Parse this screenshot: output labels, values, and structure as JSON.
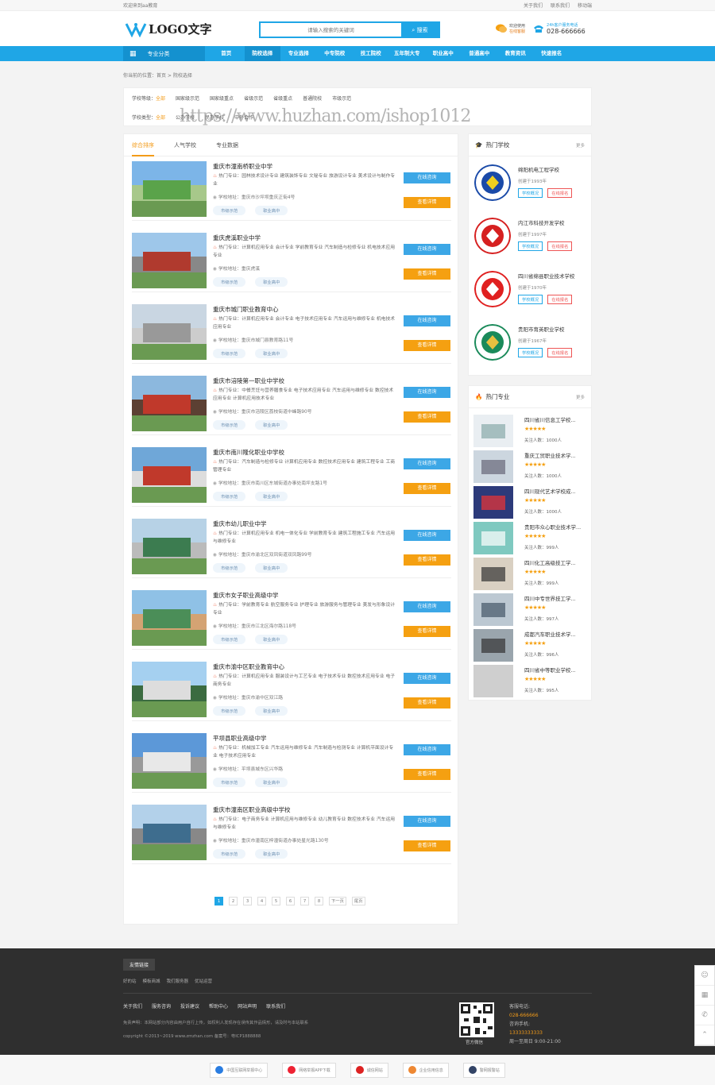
{
  "topbar": {
    "welcome": "欢迎来到aa教育",
    "links": [
      "关于我们",
      "联系我们",
      "移动端"
    ]
  },
  "header": {
    "logo_text": "LOGO文字",
    "search_placeholder": "请输入搜索的关键词",
    "search_button": "搜索",
    "contact1_line1": "欢迎使用",
    "contact1_line2": "在线客服",
    "contact2_line1": "24h客户服务电话",
    "contact2_line2": "028-666666"
  },
  "nav": {
    "category": "专业分类",
    "items": [
      "首页",
      "院校选择",
      "专业选择",
      "中专院校",
      "技工院校",
      "五年制大专",
      "职业高中",
      "普通高中",
      "教育资讯",
      "快速报名"
    ],
    "active_index": 1
  },
  "breadcrumb": "你当前的位置：首页 > 院校选择",
  "filter": {
    "level_label": "学校等级：",
    "level_options": [
      "全部",
      "国家级示范",
      "国家级重点",
      "省级示范",
      "省级重点",
      "普通院校",
      "市级示范"
    ],
    "type_label": "学校类型：",
    "type_options": [
      "全部",
      "公办学校",
      "民办学校",
      "中外合作"
    ]
  },
  "watermark": "https://www.huzhan.com/ishop1012",
  "tabs": [
    "综合排序",
    "人气学校",
    "专业数据"
  ],
  "schools": [
    {
      "name": "重庆市潼南桥职业中学",
      "majors": "热门专业：园林技术设计专业 建筑装饰专业 文秘专业 旅游设计专业 美术设计与制作专业",
      "address": "学校地址：重庆市沙坪坝重庆正街4号",
      "tags": [
        "市级示范",
        "职业高中"
      ],
      "btn1": "在线咨询",
      "btn2": "查看详情"
    },
    {
      "name": "重庆虎溪职业中学",
      "majors": "热门专业：计算机应用专业 会计专业 学前教育专业 汽车制造与检修专业 机电技术应用专业",
      "address": "学校地址：重庆虎溪",
      "tags": [
        "市级示范",
        "职业高中"
      ],
      "btn1": "在线咨询",
      "btn2": "查看详情"
    },
    {
      "name": "重庆市城门职业教育中心",
      "majors": "热门专业：计算机应用专业 会计专业 电子技术应用专业 汽车运用与维修专业 机电技术应用专业",
      "address": "学校地址：重庆市城门县教育路11号",
      "tags": [
        "市级示范",
        "职业高中"
      ],
      "btn1": "在线咨询",
      "btn2": "查看详情"
    },
    {
      "name": "重庆市涪陵第一职业中学校",
      "majors": "热门专业：中餐烹饪与营养膳食专业 电子技术应用专业 汽车运用与维修专业 数控技术应用专业 计算机应用技术专业",
      "address": "学校地址：重庆市涪陵区荔枝街道中峰路90号",
      "tags": [
        "市级示范",
        "职业高中"
      ],
      "btn1": "在线咨询",
      "btn2": "查看详情"
    },
    {
      "name": "重庆市南川隆化职业中学校",
      "majors": "热门专业：汽车制造与检修专业 计算机应用专业 数控技术应用专业 建筑工程专业 工商管理专业",
      "address": "学校地址：重庆市南川区东城街道办事处南坪支路1号",
      "tags": [
        "市级示范",
        "职业高中"
      ],
      "btn1": "在线咨询",
      "btn2": "查看详情"
    },
    {
      "name": "重庆市幼儿职业中学",
      "majors": "热门专业：计算机应用专业 机电一体化专业 学前教育专业 建筑工程施工专业 汽车运用与维修专业",
      "address": "学校地址：重庆市渝北区双凤街道双凤路99号",
      "tags": [
        "市级示范",
        "职业高中"
      ],
      "btn1": "在线咨询",
      "btn2": "查看详情"
    },
    {
      "name": "重庆市女子职业高级中学",
      "majors": "热门专业：学前教育专业 航空服务专业 护理专业 旅游服务与管理专业 美发与形象设计专业",
      "address": "学校地址：重庆市江北区海尔路118号",
      "tags": [
        "市级示范",
        "职业高中"
      ],
      "btn1": "在线咨询",
      "btn2": "查看详情"
    },
    {
      "name": "重庆市渝中区职业教育中心",
      "majors": "热门专业：计算机应用专业 服装设计与工艺专业 电子技术专业 数控技术应用专业 电子商务专业",
      "address": "学校地址：重庆市渝中区双江路",
      "tags": [
        "市级示范",
        "职业高中"
      ],
      "btn1": "在线咨询",
      "btn2": "查看详情"
    },
    {
      "name": "平坝县职业高级中学",
      "majors": "热门专业：机械加工专业 汽车运用与维修专业 汽车制造与检测专业 计算机平面设计专业 电子技术应用专业",
      "address": "学校地址：平坝县城东区兴华路",
      "tags": [
        "市级示范",
        "职业高中"
      ],
      "btn1": "在线咨询",
      "btn2": "查看详情"
    },
    {
      "name": "重庆市潼南区职业高级中学校",
      "majors": "热门专业：电子商务专业 计算机应用与维修专业 幼儿教育专业 数控技术专业 汽车运用与维修专业",
      "address": "学校地址：重庆市潼南区梓潼街道办事处星光路130号",
      "tags": [
        "市级示范",
        "职业高中"
      ],
      "btn1": "在线咨询",
      "btn2": "查看详情"
    }
  ],
  "pager": [
    "1",
    "2",
    "3",
    "4",
    "5",
    "6",
    "7",
    "8",
    "下一页",
    "尾页"
  ],
  "hot_schools": {
    "title": "热门学校",
    "more": "更多",
    "items": [
      {
        "name": "绵阳机电工程学校",
        "year": "创建于1993年",
        "b1": "学校概况",
        "b2": "在线报名"
      },
      {
        "name": "内江市科技开发学校",
        "year": "创建于1997年",
        "b1": "学校概况",
        "b2": "在线报名"
      },
      {
        "name": "四川省绵县职业技术学校",
        "year": "创建于1970年",
        "b1": "学校概况",
        "b2": "在线报名"
      },
      {
        "name": "贵阳市育英职业学校",
        "year": "创建于1967年",
        "b1": "学校概况",
        "b2": "在线报名"
      }
    ]
  },
  "hot_majors": {
    "title": "热门专业",
    "more": "更多",
    "items": [
      {
        "name": "四川省川信息工学校...",
        "stars": "★★★★★",
        "count": "关注人数：1000人"
      },
      {
        "name": "重庆工贸职业技术学...",
        "stars": "★★★★★",
        "count": "关注人数：1000人"
      },
      {
        "name": "四川现代艺术学校成...",
        "stars": "★★★★★",
        "count": "关注人数：1000人"
      },
      {
        "name": "贵阳市众心职业技术学...",
        "stars": "★★★★★",
        "count": "关注人数：999人"
      },
      {
        "name": "四川化工高级技工学...",
        "stars": "★★★★★",
        "count": "关注人数：999人"
      },
      {
        "name": "四川中专世界技工学...",
        "stars": "★★★★★",
        "count": "关注人数：997人"
      },
      {
        "name": "成都汽车职业技术学...",
        "stars": "★★★★★",
        "count": "关注人数：996人"
      },
      {
        "name": "四川省中等职业学校...",
        "stars": "★★★★★",
        "count": "关注人数：995人"
      }
    ]
  },
  "footer": {
    "links_title": "友情链接",
    "links": [
      "好的站",
      "模板商城",
      "我们服务器",
      "优站运营"
    ],
    "menu": [
      "关于我们",
      "服务咨询",
      "投诉建议",
      "帮助中心",
      "网站声明",
      "联系我们"
    ],
    "copy1": "免责声明：本网站部分内容由用户自行上传，如权利人发现存在误传其作品情形，请及时与本站联系",
    "copy2": "copyright ©2013~2019 www.zmzhan.com 备案号：粤ICP1888888",
    "qr_label": "官方微信",
    "contact": [
      "客服电话:",
      "028-666666",
      "咨询手机:",
      "13333333333",
      "周一至周日 9:00-21:00"
    ]
  },
  "badges": [
    "中国互联网举报中心",
    "网络举报APP下载",
    "诚信网站",
    "企业信用信息",
    "警网报警站"
  ]
}
